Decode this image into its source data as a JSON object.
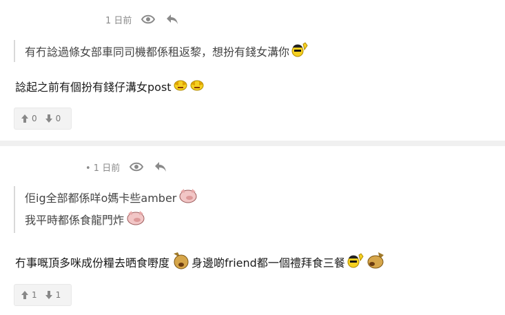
{
  "posts": [
    {
      "time": "1 日前",
      "quote_lines": [
        "有冇諗過條女部車同司機都係租返黎，想扮有錢女溝你"
      ],
      "body": "諗起之前有個扮有錢仔溝女post",
      "upvotes": "0",
      "downvotes": "0"
    },
    {
      "time": "• 1 日前",
      "quote_lines": [
        "佢ig全部都係咩o媽卡些amber",
        "我平時都係食龍門炸"
      ],
      "body_parts": [
        "冇事嘅頂多咪成份糧去晒食嘢度",
        " 身邊啲friend都一個禮拜食三餐"
      ],
      "upvotes": "1",
      "downvotes": "1"
    }
  ],
  "icons": [
    "eye-icon",
    "reply-icon",
    "thumbs-up-icon",
    "thumbs-down-icon",
    "emoji-icon"
  ]
}
